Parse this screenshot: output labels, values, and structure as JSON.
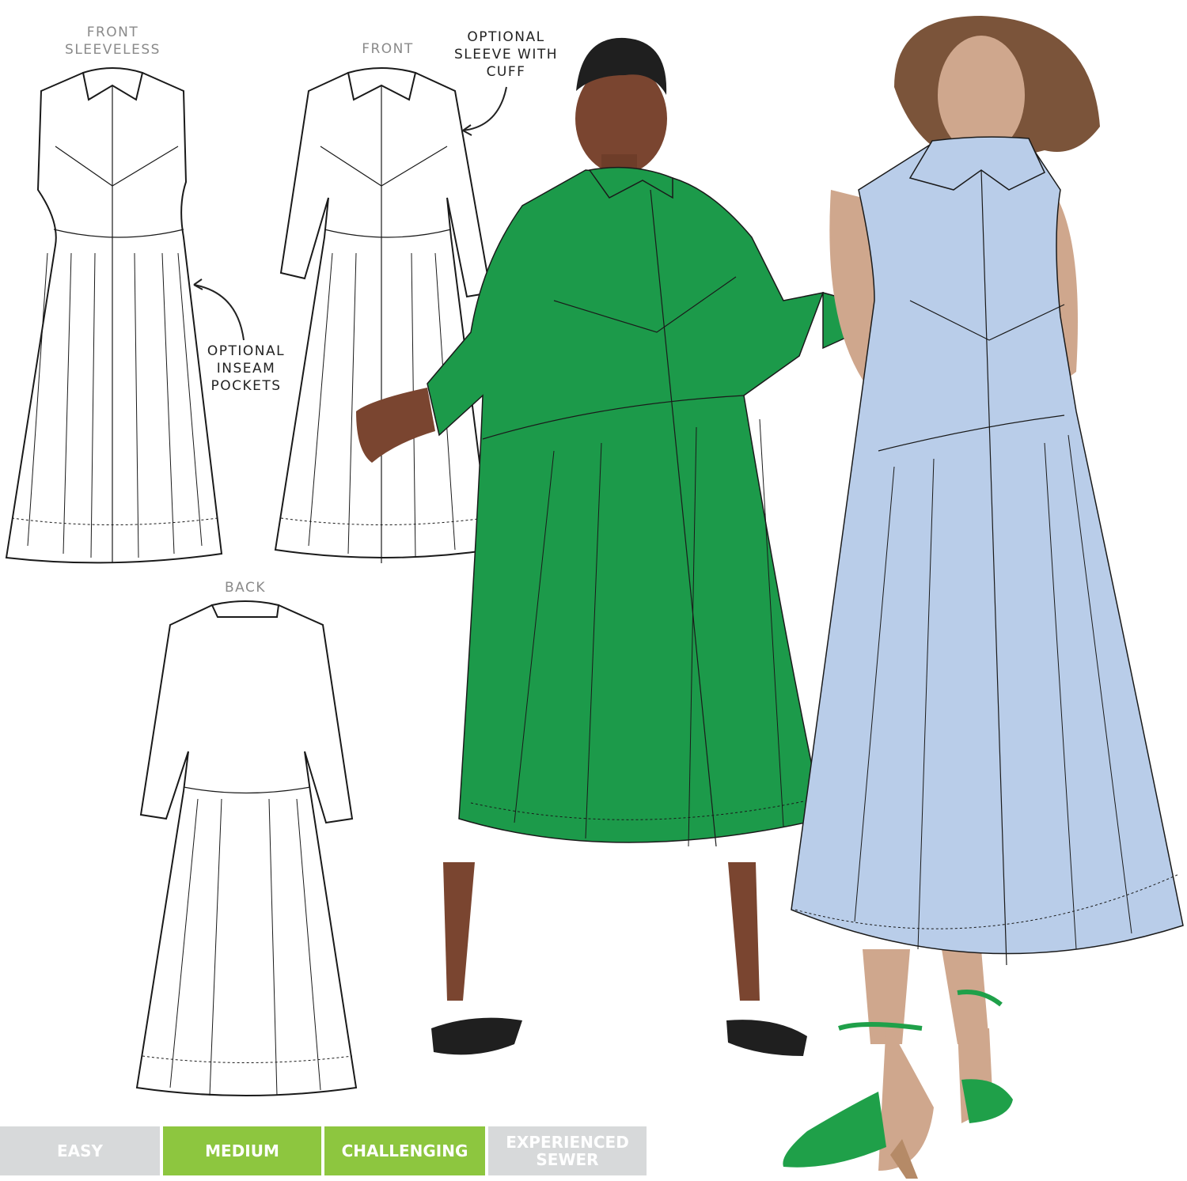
{
  "labels": {
    "front_sleeveless": "FRONT\nSLEEVELESS",
    "front": "FRONT",
    "back": "BACK",
    "optional_sleeve": "OPTIONAL\nSLEEVE WITH\nCUFF",
    "optional_pockets": "OPTIONAL\nINSEAM\nPOCKETS"
  },
  "difficulty": {
    "levels": [
      {
        "label": "EASY",
        "active": false
      },
      {
        "label": "MEDIUM",
        "active": true
      },
      {
        "label": "CHALLENGING",
        "active": true
      },
      {
        "label": "EXPERIENCED\nSEWER",
        "active": false
      }
    ],
    "active_color": "#8dc63f",
    "inactive_color": "#d7d9da"
  },
  "colors": {
    "green_dress": "#1c9a4a",
    "blue_dress": "#b9cde9",
    "skin_dark": "#7a4530",
    "skin_light": "#cfa78d",
    "hair": "#7b543a"
  }
}
